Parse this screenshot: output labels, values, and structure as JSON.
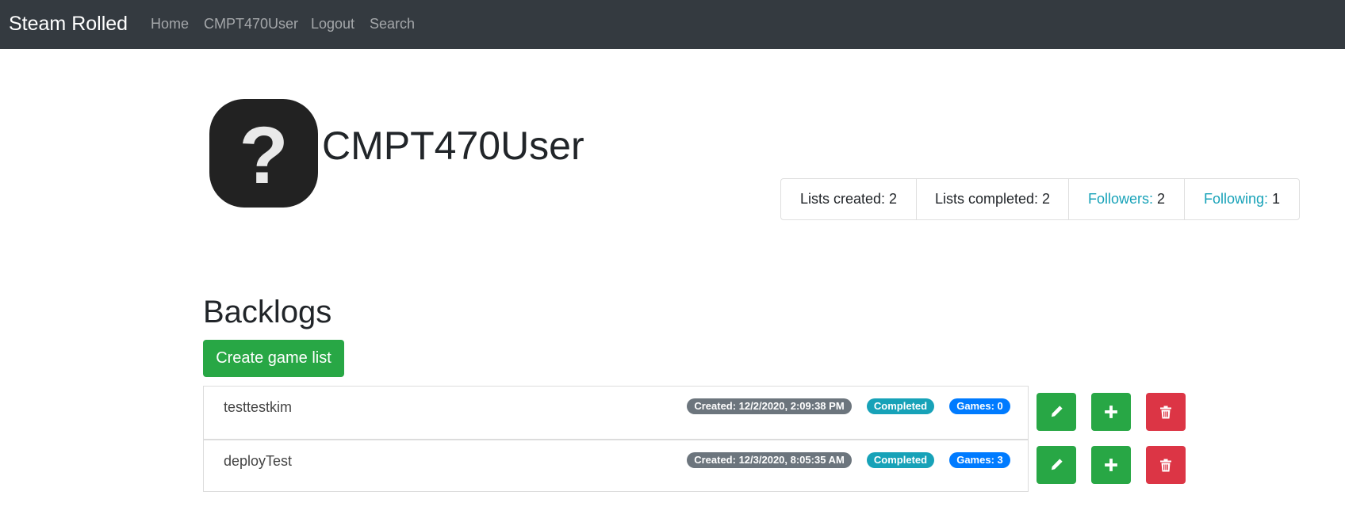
{
  "navbar": {
    "brand": "Steam Rolled",
    "links": [
      "Home",
      "CMPT470User",
      "Logout",
      "Search"
    ]
  },
  "profile": {
    "avatar_icon": "question-mark-icon",
    "avatar_glyph": "?",
    "username": "CMPT470User",
    "stats": {
      "lists_created_label": "Lists created:",
      "lists_created_value": "2",
      "lists_completed_label": "Lists completed:",
      "lists_completed_value": "2",
      "followers_label": "Followers:",
      "followers_value": "2",
      "following_label": "Following:",
      "following_value": "1"
    }
  },
  "backlogs": {
    "title": "Backlogs",
    "create_button": "Create game list",
    "lists": [
      {
        "name": "testtestkim",
        "created": "Created: 12/2/2020, 2:09:38 PM",
        "status": "Completed",
        "games": "Games: 0"
      },
      {
        "name": "deployTest",
        "created": "Created: 12/3/2020, 8:05:35 AM",
        "status": "Completed",
        "games": "Games: 3"
      }
    ],
    "action_icons": [
      "pencil-icon",
      "plus-icon",
      "trash-icon"
    ]
  },
  "colors": {
    "navbar_bg": "#343a40",
    "success": "#28a745",
    "danger": "#dc3545",
    "info": "#17a2b8",
    "primary": "#007bff",
    "secondary": "#6c757d"
  }
}
